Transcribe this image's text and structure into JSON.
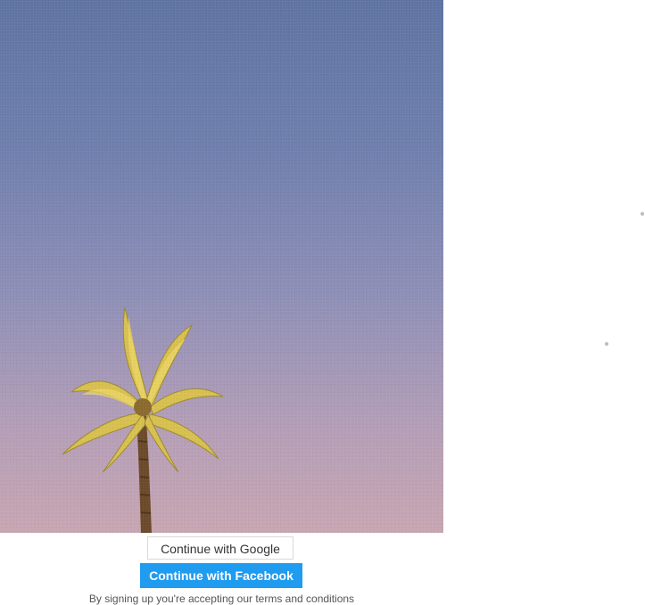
{
  "hero": {
    "image_subject": "palm-tree",
    "colors": {
      "sky_top": "#5f74a3",
      "sky_bottom": "#c8a6b2",
      "palm_leaves": "#d8c04f",
      "trunk": "#6b4a2a"
    }
  },
  "auth": {
    "google_label": "Continue with Google",
    "facebook_label": "Continue with Facebook",
    "terms_text": "By signing up you're accepting our terms and conditions",
    "facebook_color": "#1f9bf0"
  }
}
